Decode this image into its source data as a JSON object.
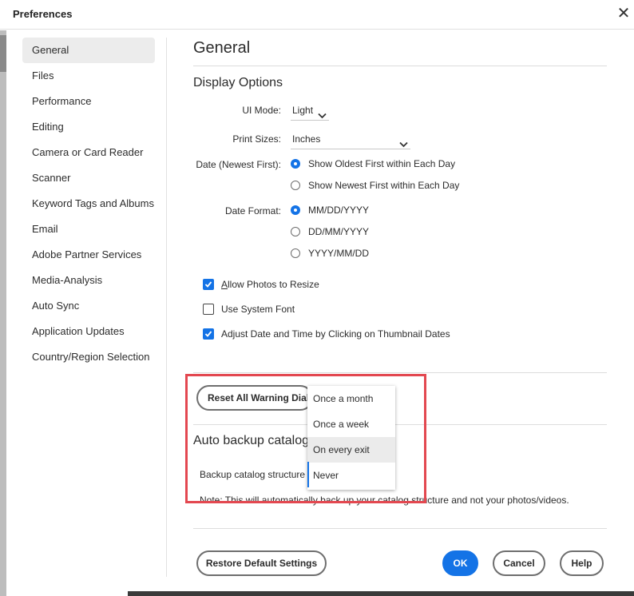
{
  "window": {
    "title": "Preferences"
  },
  "sidebar": {
    "items": [
      {
        "label": "General",
        "active": true
      },
      {
        "label": "Files"
      },
      {
        "label": "Performance"
      },
      {
        "label": "Editing"
      },
      {
        "label": "Camera or Card Reader"
      },
      {
        "label": "Scanner"
      },
      {
        "label": "Keyword Tags and Albums"
      },
      {
        "label": "Email"
      },
      {
        "label": "Adobe Partner Services"
      },
      {
        "label": "Media-Analysis"
      },
      {
        "label": "Auto Sync"
      },
      {
        "label": "Application Updates"
      },
      {
        "label": "Country/Region Selection"
      }
    ]
  },
  "main": {
    "heading": "General",
    "display_options": {
      "heading": "Display Options",
      "ui_mode": {
        "label": "UI Mode:",
        "value": "Light"
      },
      "print_sizes": {
        "label": "Print Sizes:",
        "value": "Inches"
      },
      "date_order": {
        "label": "Date (Newest First):",
        "options": [
          "Show Oldest First within Each Day",
          "Show Newest First within Each Day"
        ],
        "selected": "Show Oldest First within Each Day"
      },
      "date_format": {
        "label": "Date Format:",
        "options": [
          "MM/DD/YYYY",
          "DD/MM/YYYY",
          "YYYY/MM/DD"
        ],
        "selected": "MM/DD/YYYY"
      }
    },
    "checkboxes": [
      {
        "label": "Allow Photos to Resize",
        "checked": true
      },
      {
        "label": "Use System Font",
        "checked": false
      },
      {
        "label": "Adjust Date and Time by Clicking on Thumbnail Dates",
        "checked": true
      }
    ],
    "reset_warning_button": "Reset All Warning Dial",
    "auto_backup": {
      "heading": "Auto backup catalog",
      "structure_label": "Backup catalog structure",
      "options": [
        "Once a month",
        "Once a week",
        "On every exit",
        "Never"
      ],
      "hovered": "On every exit",
      "note": "Note: This will automatically back up your catalog structure and not your photos/videos."
    }
  },
  "footer": {
    "restore_label": "Restore Default Settings",
    "ok_label": "OK",
    "cancel_label": "Cancel",
    "help_label": "Help"
  },
  "colors": {
    "accent": "#1473e6",
    "highlight_box": "#e34850"
  },
  "icons": {
    "close": "close-icon",
    "dropdown": "chevron-down-icon",
    "check": "checkmark-icon"
  }
}
